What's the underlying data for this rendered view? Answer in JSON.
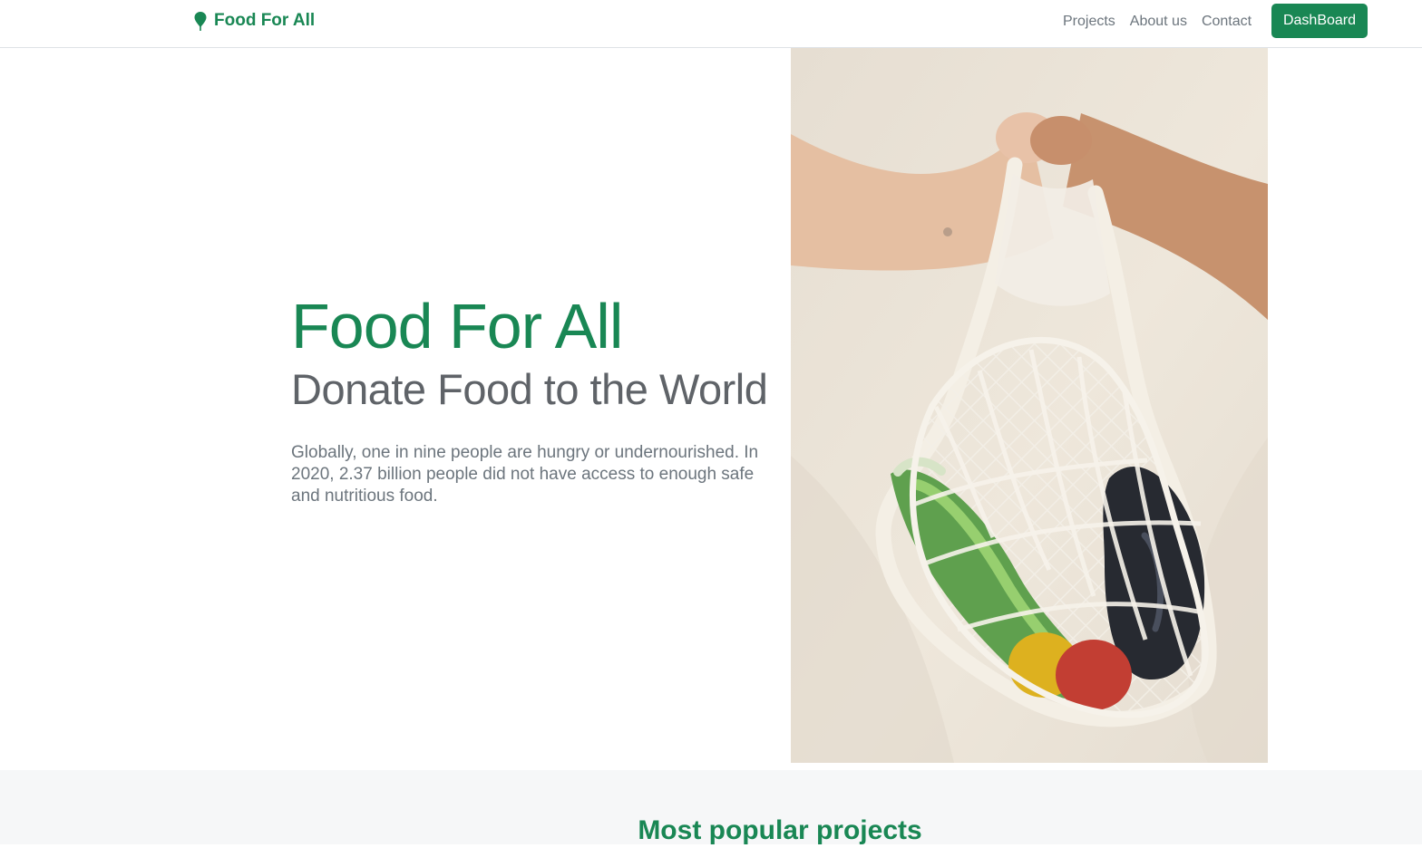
{
  "navbar": {
    "brand_label": "Food For All",
    "brand_icon": "map-pin-icon",
    "links": [
      "Projects",
      "About us",
      "Contact"
    ],
    "dashboard_label": "DashBoard",
    "accent_color": "#198754"
  },
  "hero": {
    "title": "Food For All",
    "subtitle": "Donate Food to the World",
    "body": "Globally, one in nine people are hungry or undernourished. In 2020, 2.37 billion people did not have access to enough safe and nutritious food.",
    "image_icon": "produce-net-bag-photo"
  },
  "projects": {
    "title": "Most popular projects"
  }
}
